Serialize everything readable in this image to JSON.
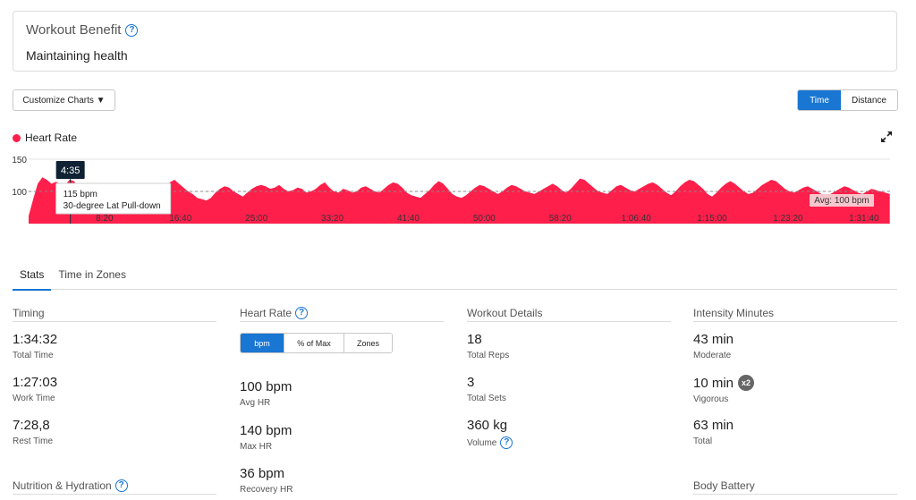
{
  "workout_benefit": {
    "title": "Workout Benefit",
    "value": "Maintaining health"
  },
  "controls": {
    "customize_label": "Customize Charts ▼",
    "toggle": [
      {
        "label": "Time",
        "active": true
      },
      {
        "label": "Distance",
        "active": false
      }
    ]
  },
  "chart": {
    "legend": "Heart Rate",
    "color": "#ff1f4b",
    "tooltip": {
      "time": "4:35",
      "line1": "115 bpm",
      "line2": "30-degree Lat Pull-down"
    },
    "avg_label": "Avg: 100 bpm"
  },
  "chart_data": {
    "type": "area",
    "title": "",
    "series": [
      {
        "name": "Heart Rate",
        "x": [
          0,
          0.5,
          1,
          1.5,
          2,
          2.5,
          3,
          3.5,
          4,
          4.5,
          5,
          5.5,
          6,
          6.5,
          7,
          7.5,
          8,
          8.5,
          9,
          9.5,
          10,
          10.5,
          11,
          11.5,
          12,
          12.5,
          13,
          13.5,
          14,
          14.5,
          15,
          15.5,
          16,
          16.5,
          17,
          17.5,
          18,
          18.5,
          19,
          19.5,
          20,
          20.5,
          21,
          21.5,
          22,
          22.5,
          23,
          23.5,
          24,
          24.5,
          25,
          25.5,
          26,
          26.5,
          27,
          27.5,
          28,
          28.5,
          29,
          29.5,
          30,
          30.5,
          31,
          31.5,
          32,
          32.5,
          33,
          33.5,
          34,
          34.5,
          35,
          35.5,
          36,
          36.5,
          37,
          37.5,
          38,
          38.5,
          39,
          39.5,
          40,
          40.5,
          41,
          41.5,
          42,
          42.5,
          43,
          43.5,
          44,
          44.5,
          45,
          45.5,
          46,
          46.5,
          47,
          47.5,
          48,
          48.5,
          49,
          49.5,
          50,
          50.5,
          51,
          51.5,
          52,
          52.5,
          53,
          53.5,
          54,
          54.5,
          55,
          55.5,
          56,
          56.5,
          57,
          57.5,
          58,
          58.5,
          59,
          59.5,
          60,
          60.5,
          61,
          61.5,
          62,
          62.5,
          63,
          63.5,
          64,
          64.5,
          65,
          65.5,
          66,
          66.5,
          67,
          67.5,
          68,
          68.5,
          69,
          69.5,
          70,
          70.5,
          71,
          71.5,
          72,
          72.5,
          73,
          73.5,
          74,
          74.5,
          75,
          75.5,
          76,
          76.5,
          77,
          77.5,
          78,
          78.5,
          79,
          79.5,
          80,
          80.5,
          81,
          81.5,
          82,
          82.5,
          83,
          83.5,
          84,
          84.5,
          85,
          85.5,
          86,
          86.5,
          87,
          87.5,
          88,
          88.5,
          89,
          89.5,
          90,
          90.5,
          91,
          91.5,
          92,
          92.5,
          93,
          93.5,
          94,
          94.5
        ],
        "values": [
          62,
          88,
          112,
          122,
          118,
          112,
          115,
          112,
          110,
          118,
          116,
          104,
          92,
          86,
          80,
          78,
          84,
          94,
          96,
          92,
          86,
          82,
          80,
          78,
          84,
          88,
          82,
          78,
          76,
          90,
          104,
          114,
          118,
          112,
          106,
          100,
          96,
          90,
          88,
          86,
          90,
          98,
          104,
          108,
          106,
          100,
          96,
          92,
          98,
          104,
          108,
          110,
          108,
          104,
          106,
          110,
          104,
          100,
          102,
          106,
          104,
          98,
          100,
          104,
          110,
          114,
          106,
          100,
          98,
          104,
          102,
          98,
          100,
          106,
          108,
          104,
          100,
          98,
          104,
          110,
          114,
          112,
          106,
          98,
          94,
          92,
          90,
          96,
          102,
          110,
          116,
          112,
          104,
          96,
          92,
          90,
          94,
          100,
          106,
          110,
          108,
          104,
          100,
          96,
          100,
          106,
          110,
          108,
          104,
          100,
          98,
          96,
          100,
          104,
          108,
          112,
          108,
          102,
          98,
          104,
          112,
          120,
          118,
          112,
          106,
          100,
          98,
          96,
          102,
          108,
          110,
          106,
          102,
          100,
          104,
          108,
          112,
          114,
          110,
          104,
          98,
          94,
          100,
          108,
          114,
          118,
          116,
          110,
          104,
          96,
          92,
          98,
          106,
          112,
          116,
          112,
          106,
          100,
          96,
          98,
          104,
          110,
          114,
          118,
          116,
          110,
          104,
          100,
          98,
          102,
          106,
          108,
          104,
          100,
          96,
          94,
          96,
          100,
          104,
          108,
          106,
          102,
          98,
          96,
          100,
          104,
          102,
          100,
          98,
          96
        ]
      }
    ],
    "xlabel": "",
    "ylabel": "",
    "x_tick_labels": [
      "8:20",
      "16:40",
      "25:00",
      "33:20",
      "41:40",
      "50:00",
      "58:20",
      "1:06:40",
      "1:15:00",
      "1:23:20",
      "1:31:40"
    ],
    "y_ticks": [
      50,
      100,
      150
    ],
    "ylim": [
      50,
      150
    ],
    "xlim": [
      0,
      94.53
    ],
    "tooltip_x": 4.58,
    "avg_y": 100,
    "grid": true
  },
  "tabs": [
    {
      "label": "Stats",
      "active": true
    },
    {
      "label": "Time in Zones",
      "active": false
    }
  ],
  "timing": {
    "header": "Timing",
    "stats": [
      {
        "value": "1:34:32",
        "label": "Total Time"
      },
      {
        "value": "1:27:03",
        "label": "Work Time"
      },
      {
        "value": "7:28,8",
        "label": "Rest Time"
      }
    ]
  },
  "heart_rate": {
    "header": "Heart Rate",
    "units": [
      {
        "label": "bpm",
        "active": true
      },
      {
        "label": "% of Max",
        "active": false
      },
      {
        "label": "Zones",
        "active": false
      }
    ],
    "stats": [
      {
        "value": "100 bpm",
        "label": "Avg HR"
      },
      {
        "value": "140 bpm",
        "label": "Max HR"
      },
      {
        "value": "36 bpm",
        "label": "Recovery HR"
      }
    ]
  },
  "workout_details": {
    "header": "Workout Details",
    "stats": [
      {
        "value": "18",
        "label": "Total Reps"
      },
      {
        "value": "3",
        "label": "Total Sets"
      },
      {
        "value": "360 kg",
        "label": "Volume"
      }
    ]
  },
  "intensity": {
    "header": "Intensity Minutes",
    "badge": "x2",
    "stats": [
      {
        "value": "43 min",
        "label": "Moderate"
      },
      {
        "value": "10 min",
        "label": "Vigorous"
      },
      {
        "value": "63 min",
        "label": "Total"
      }
    ]
  },
  "nutrition": {
    "header": "Nutrition & Hydration"
  },
  "body_battery": {
    "header": "Body Battery"
  }
}
